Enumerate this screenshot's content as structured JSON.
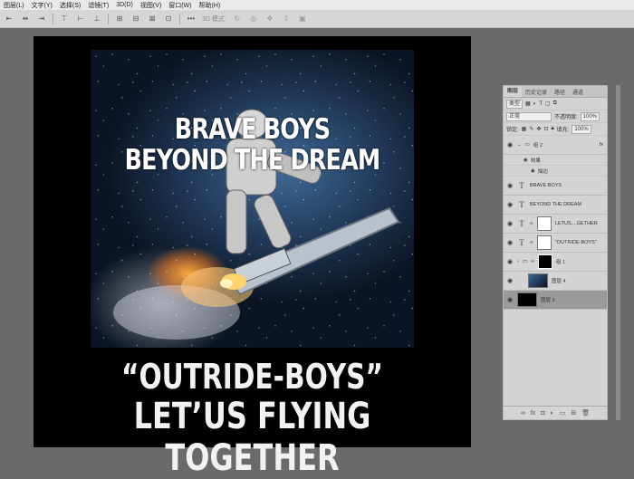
{
  "menu": [
    "图层(L)",
    "文字(Y)",
    "选择(S)",
    "滤镜(T)",
    "3D(D)",
    "视图(V)",
    "窗口(W)",
    "帮助(H)"
  ],
  "options": {
    "mode_label": "3D 模式:",
    "more": "•••"
  },
  "artwork": {
    "line1": "BRAVE BOYS",
    "line2": "BEYOND THE DREAM",
    "caption1": "“OUTRIDE-BOYS”",
    "caption2": "LET’US FLYING TOGETHER"
  },
  "panel": {
    "tabs": [
      "图层",
      "历史记录",
      "路径",
      "通道"
    ],
    "filter_select": "类型",
    "blend_select": "正常",
    "opacity_label": "不透明度:",
    "opacity_value": "100%",
    "lock_label": "锁定:",
    "fill_label": "填充:",
    "fill_value": "100%",
    "group2": "组 2",
    "fx": "fx",
    "effects": "效果",
    "stroke": "描边",
    "layers": [
      {
        "type": "text",
        "name": "BRAVE BOYS"
      },
      {
        "type": "text",
        "name": "BEYOND THE DREAM"
      },
      {
        "type": "text-mask",
        "name": "LETUS....GETHER"
      },
      {
        "type": "text-mask",
        "name": "\"OUTRIDE-BOYS\""
      },
      {
        "type": "group",
        "name": "组 1"
      },
      {
        "type": "image",
        "name": "图层 4"
      },
      {
        "type": "fill",
        "name": "图层 3"
      }
    ]
  }
}
